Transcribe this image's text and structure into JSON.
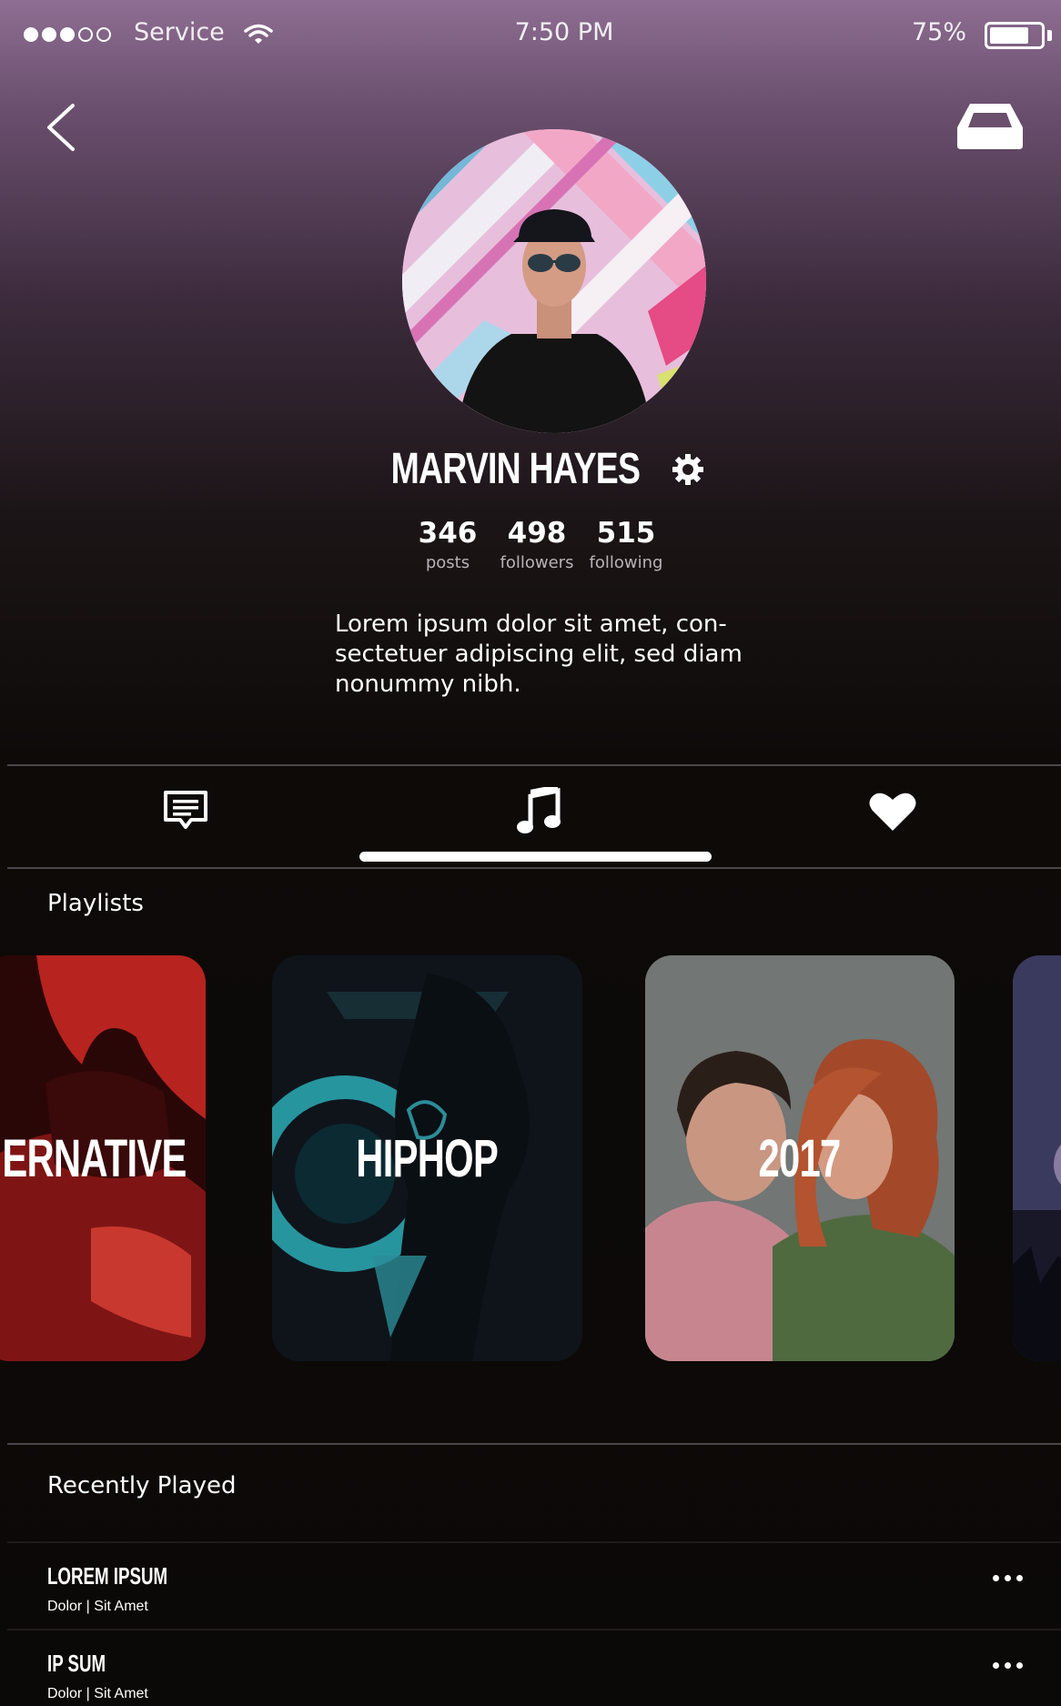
{
  "status_bar": {
    "carrier": "Service",
    "time": "7:50 PM",
    "battery": "75%",
    "battery_level": 0.75,
    "signal_bars": 3,
    "signal_total": 5
  },
  "profile": {
    "name": "MARVIN HAYES",
    "stats": [
      {
        "value": "346",
        "label": "posts"
      },
      {
        "value": "498",
        "label": "followers"
      },
      {
        "value": "515",
        "label": "following"
      }
    ],
    "bio": "Lorem ipsum dolor sit amet, con-sectetuer adipiscing elit, sed diam nonummy nibh."
  },
  "tabs": [
    {
      "icon": "message-icon",
      "active": false
    },
    {
      "icon": "music-note-icon",
      "active": true
    },
    {
      "icon": "heart-icon",
      "active": false
    }
  ],
  "playlists": {
    "title": "Playlists",
    "items": [
      {
        "label": "ERNATIVE"
      },
      {
        "label": "HIPHOP"
      },
      {
        "label": "2017"
      }
    ]
  },
  "recently_played": {
    "title": "Recently Played",
    "tracks": [
      {
        "title": "LOREM IPSUM",
        "subtitle": "Dolor | Sit Amet"
      },
      {
        "title": "IP SUM",
        "subtitle": "Dolor | Sit Amet"
      }
    ]
  },
  "colors": {
    "header_gradient_top": "#8e6e92",
    "background": "#0b0907",
    "accent": "#ffffff"
  }
}
